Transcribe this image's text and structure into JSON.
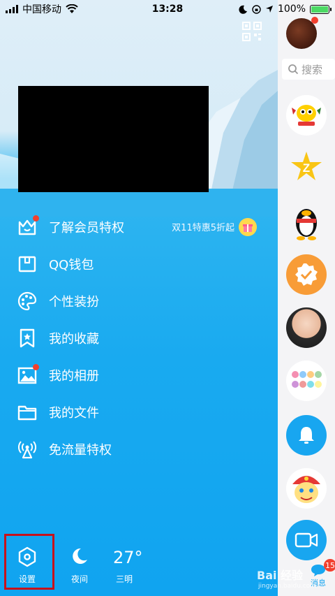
{
  "status_bar": {
    "carrier": "中国移动",
    "time": "13:28",
    "battery": "100%",
    "battery_level": 1.0
  },
  "drawer": {
    "menu": [
      {
        "label": "了解会员特权",
        "icon": "crown-icon",
        "dot": true
      },
      {
        "label": "QQ钱包",
        "icon": "wallet-icon",
        "dot": false
      },
      {
        "label": "个性装扮",
        "icon": "palette-icon",
        "dot": false
      },
      {
        "label": "我的收藏",
        "icon": "bookmark-icon",
        "dot": false
      },
      {
        "label": "我的相册",
        "icon": "photo-icon",
        "dot": true
      },
      {
        "label": "我的文件",
        "icon": "folder-icon",
        "dot": false
      },
      {
        "label": "免流量特权",
        "icon": "signal-tower-icon",
        "dot": false
      }
    ],
    "promo_text": "双11特惠5折起",
    "bottom": {
      "settings_label": "设置",
      "night_label": "夜间",
      "temperature": "27°",
      "city": "三明"
    }
  },
  "sidebar": {
    "search_placeholder": "搜索",
    "messages_label": "消息",
    "messages_count": "15"
  },
  "watermark": {
    "text": "Bai 经验",
    "url": "jingyan.baidu.com"
  }
}
